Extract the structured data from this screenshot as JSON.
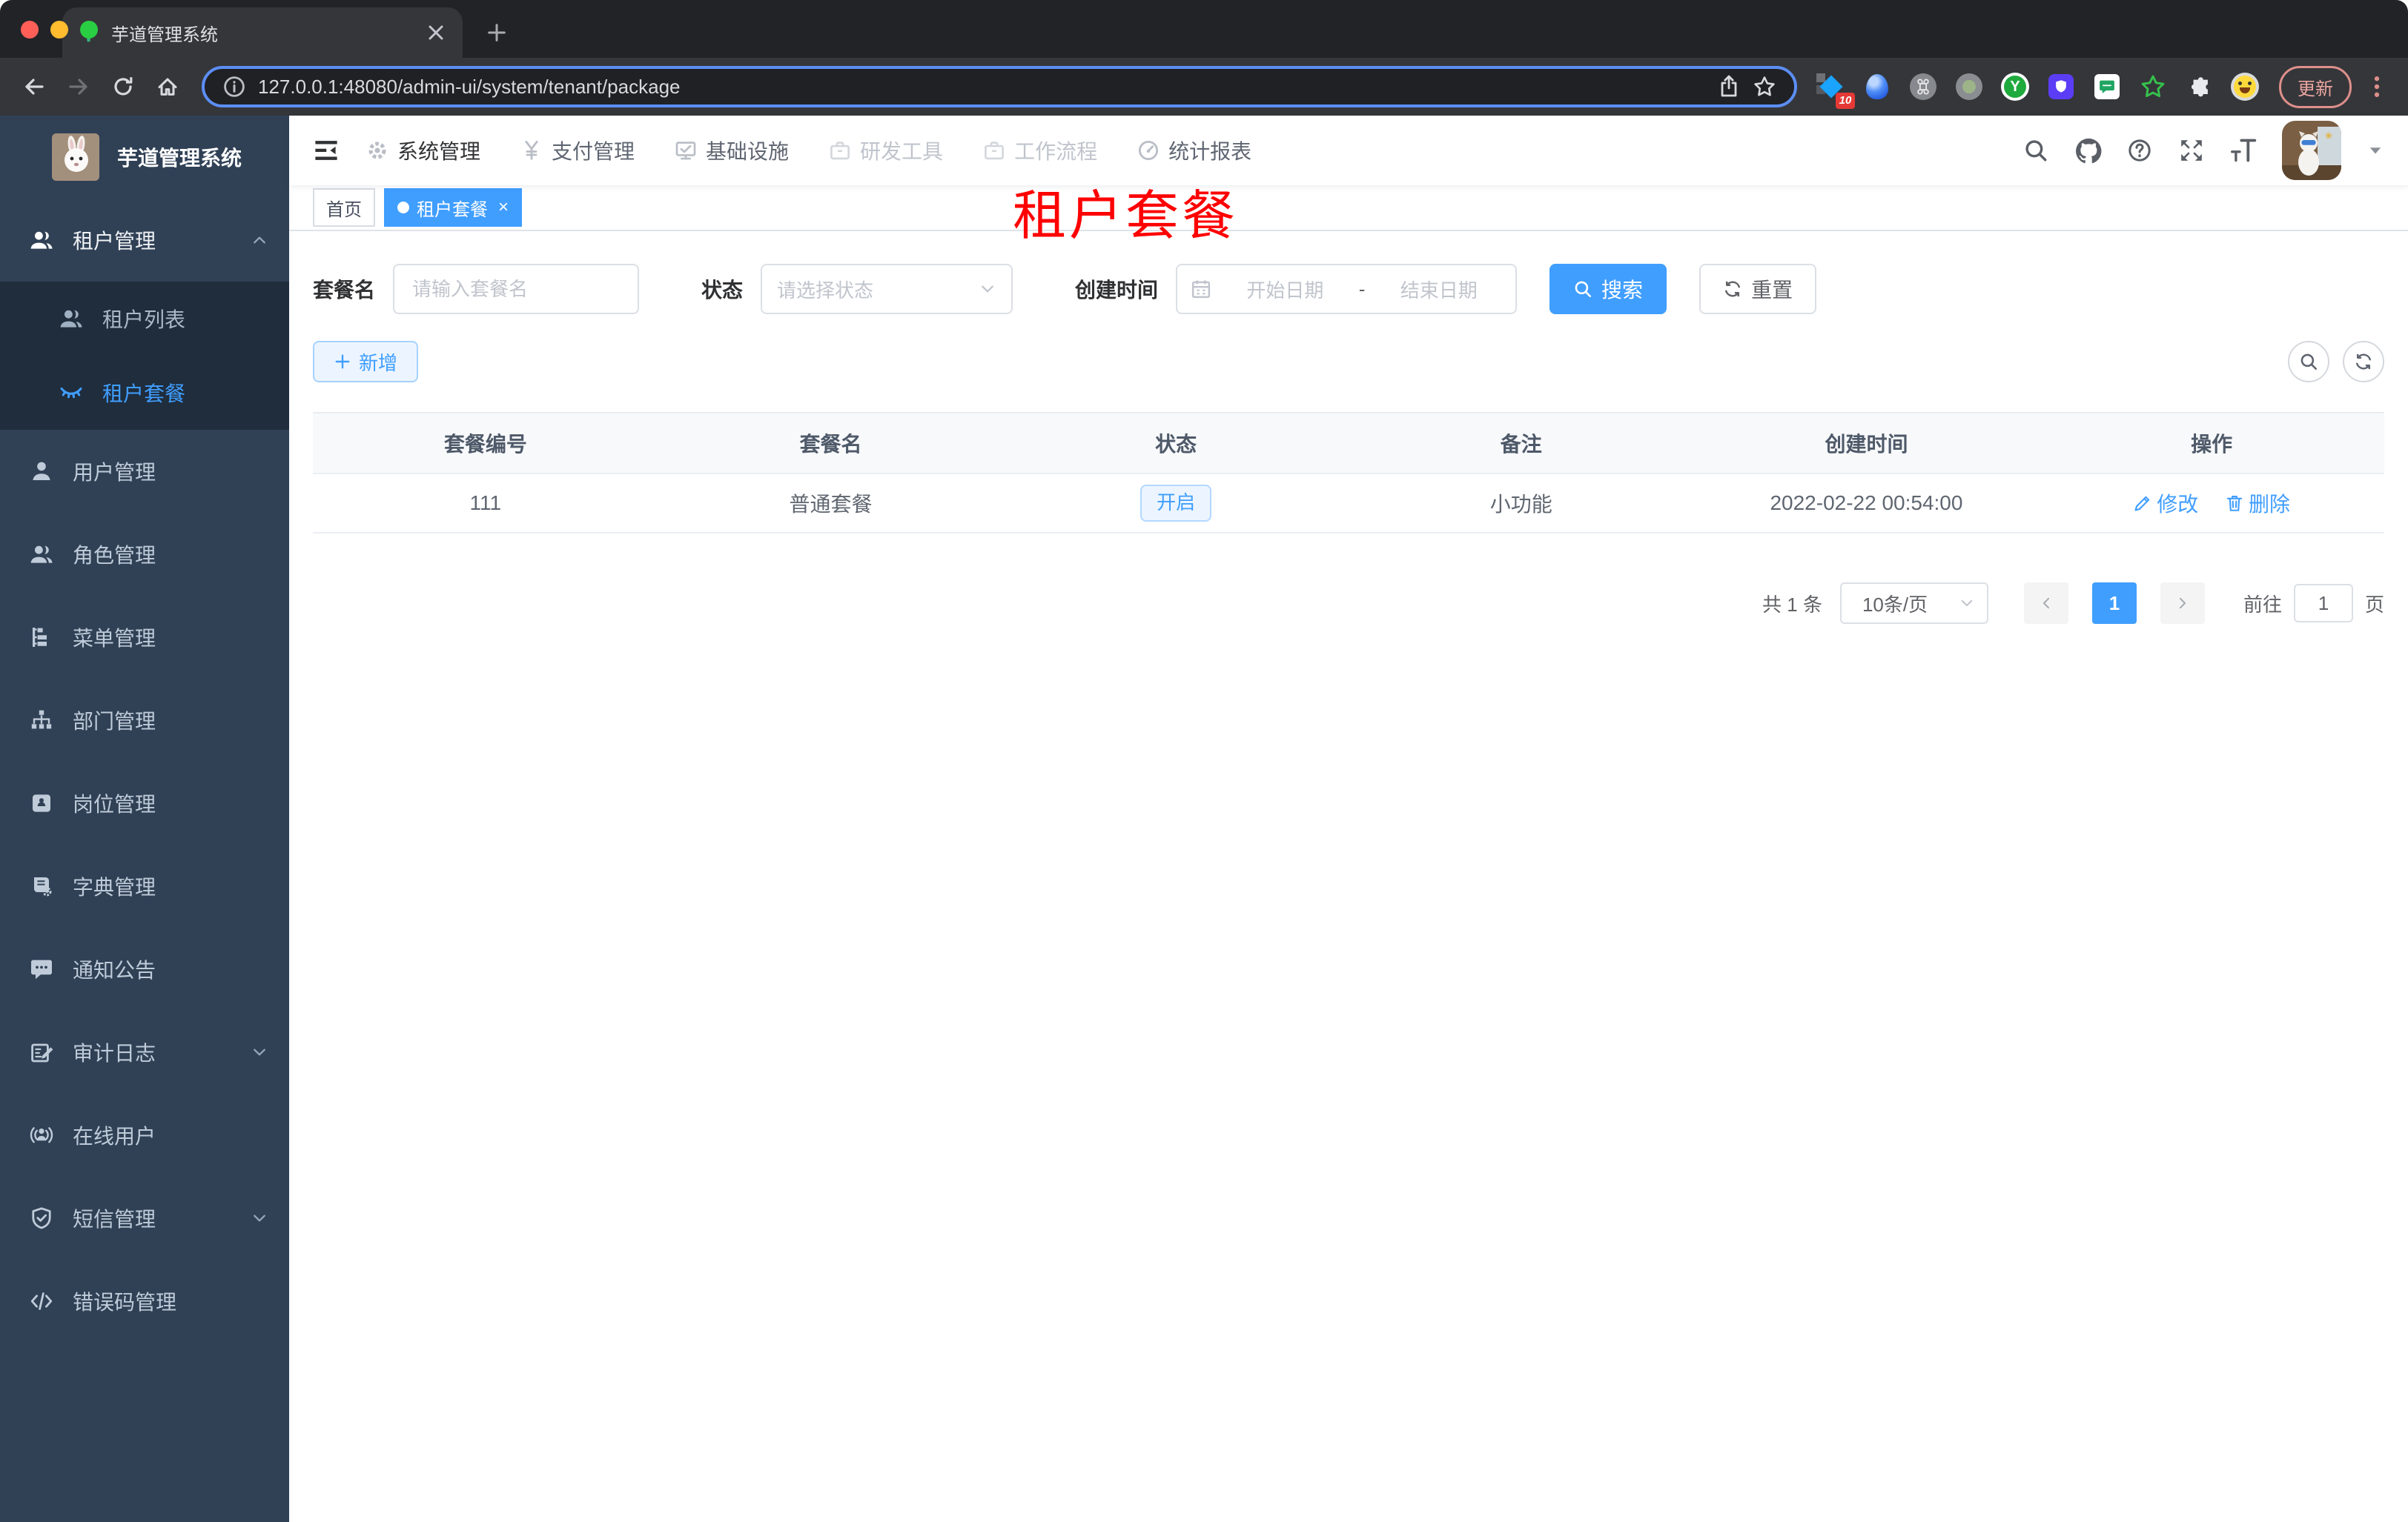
{
  "browser": {
    "tab_title": "芋道管理系统",
    "url": "127.0.0.1:48080/admin-ui/system/tenant/package",
    "extension_badge": "10",
    "update_label": "更新"
  },
  "sidebar": {
    "logo_title": "芋道管理系统",
    "tenant_parent": "租户管理",
    "tenant_list": "租户列表",
    "tenant_package": "租户套餐",
    "items": [
      {
        "label": "用户管理"
      },
      {
        "label": "角色管理"
      },
      {
        "label": "菜单管理"
      },
      {
        "label": "部门管理"
      },
      {
        "label": "岗位管理"
      },
      {
        "label": "字典管理"
      },
      {
        "label": "通知公告"
      },
      {
        "label": "审计日志"
      },
      {
        "label": "在线用户"
      },
      {
        "label": "短信管理"
      },
      {
        "label": "错误码管理"
      }
    ]
  },
  "topnav": {
    "items": [
      {
        "label": "系统管理"
      },
      {
        "label": "支付管理"
      },
      {
        "label": "基础设施"
      },
      {
        "label": "研发工具"
      },
      {
        "label": "工作流程"
      },
      {
        "label": "统计报表"
      }
    ]
  },
  "tags": {
    "home": "首页",
    "current": "租户套餐"
  },
  "page_title": "租户套餐",
  "filter": {
    "name_label": "套餐名",
    "name_placeholder": "请输入套餐名",
    "status_label": "状态",
    "status_placeholder": "请选择状态",
    "date_label": "创建时间",
    "date_start": "开始日期",
    "date_sep": "-",
    "date_end": "结束日期",
    "search": "搜索",
    "reset": "重置"
  },
  "toolbar": {
    "add": "新增"
  },
  "table": {
    "columns": [
      "套餐编号",
      "套餐名",
      "状态",
      "备注",
      "创建时间",
      "操作"
    ],
    "rows": [
      {
        "id": "111",
        "name": "普通套餐",
        "status": "开启",
        "remark": "小功能",
        "created": "2022-02-22 00:54:00",
        "edit": "修改",
        "delete": "删除"
      }
    ]
  },
  "pagination": {
    "total": "共 1 条",
    "page_size": "10条/页",
    "current_page": "1",
    "goto_label": "前往",
    "goto_value": "1",
    "goto_unit": "页"
  },
  "colors": {
    "accent": "#409eff",
    "sidebar_bg": "#304156",
    "submenu_bg": "#1f2d3d",
    "page_title_red": "#fe0000",
    "status_tag_bg": "#ecf5ff"
  },
  "icons": [
    "plant-favicon",
    "back",
    "forward",
    "reload",
    "home",
    "info",
    "share",
    "bookmark-star",
    "new-tab-plus",
    "close",
    "menu-kebab",
    "hamburger-fold",
    "gear",
    "yen",
    "monitor-check",
    "briefcase",
    "dashboard",
    "search",
    "github",
    "help",
    "fullscreen",
    "font-size",
    "caret-down",
    "user",
    "users",
    "eye-closed",
    "tree-list",
    "org-chart",
    "id-badge",
    "book-gear",
    "chat-bubble",
    "edit-log",
    "online-signal",
    "shield-check",
    "code",
    "chevron-up",
    "chevron-down",
    "calendar",
    "refresh",
    "edit-pen",
    "trash"
  ]
}
